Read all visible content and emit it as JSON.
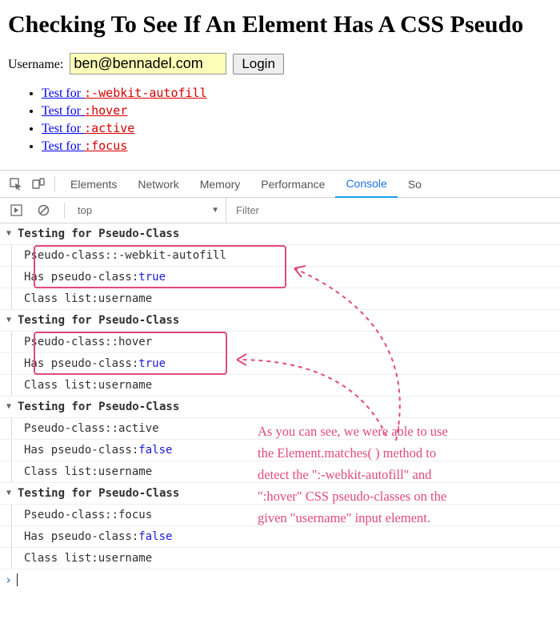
{
  "page": {
    "title": "Checking To See If An Element Has A CSS Pseudo",
    "label": "Username:",
    "input_value": "ben@bennadel.com",
    "login": "Login"
  },
  "tests": [
    {
      "prefix": "Test for ",
      "code": ":-webkit-autofill"
    },
    {
      "prefix": "Test for ",
      "code": ":hover"
    },
    {
      "prefix": "Test for ",
      "code": ":active"
    },
    {
      "prefix": "Test for ",
      "code": ":focus"
    }
  ],
  "devtools": {
    "tabs": [
      "Elements",
      "Network",
      "Memory",
      "Performance",
      "Console",
      "So"
    ],
    "active_tab": "Console",
    "context": "top",
    "filter_placeholder": "Filter"
  },
  "groups": [
    {
      "head": "Testing for Pseudo-Class",
      "rows": [
        {
          "k": "Pseudo-class:",
          "v": ":-webkit-autofill"
        },
        {
          "k": "Has pseudo-class:",
          "v": "true",
          "bool": true
        },
        {
          "k": "Class list:",
          "v": "username"
        }
      ]
    },
    {
      "head": "Testing for Pseudo-Class",
      "rows": [
        {
          "k": "Pseudo-class:",
          "v": ":hover"
        },
        {
          "k": "Has pseudo-class:",
          "v": "true",
          "bool": true
        },
        {
          "k": "Class list:",
          "v": "username"
        }
      ]
    },
    {
      "head": "Testing for Pseudo-Class",
      "rows": [
        {
          "k": "Pseudo-class:",
          "v": ":active"
        },
        {
          "k": "Has pseudo-class:",
          "v": "false",
          "bool": true
        },
        {
          "k": "Class list:",
          "v": "username"
        }
      ]
    },
    {
      "head": "Testing for Pseudo-Class",
      "rows": [
        {
          "k": "Pseudo-class:",
          "v": ":focus"
        },
        {
          "k": "Has pseudo-class:",
          "v": "false",
          "bool": true
        },
        {
          "k": "Class list:",
          "v": "username"
        }
      ]
    }
  ],
  "annotation": {
    "line1": "As you can see, we were able to use",
    "line2": "the Element.matches( ) method to",
    "line3": "detect the \":-webkit-autofill\" and",
    "line4": "\":hover\" CSS pseudo-classes on the",
    "line5": "given \"username\" input element."
  }
}
